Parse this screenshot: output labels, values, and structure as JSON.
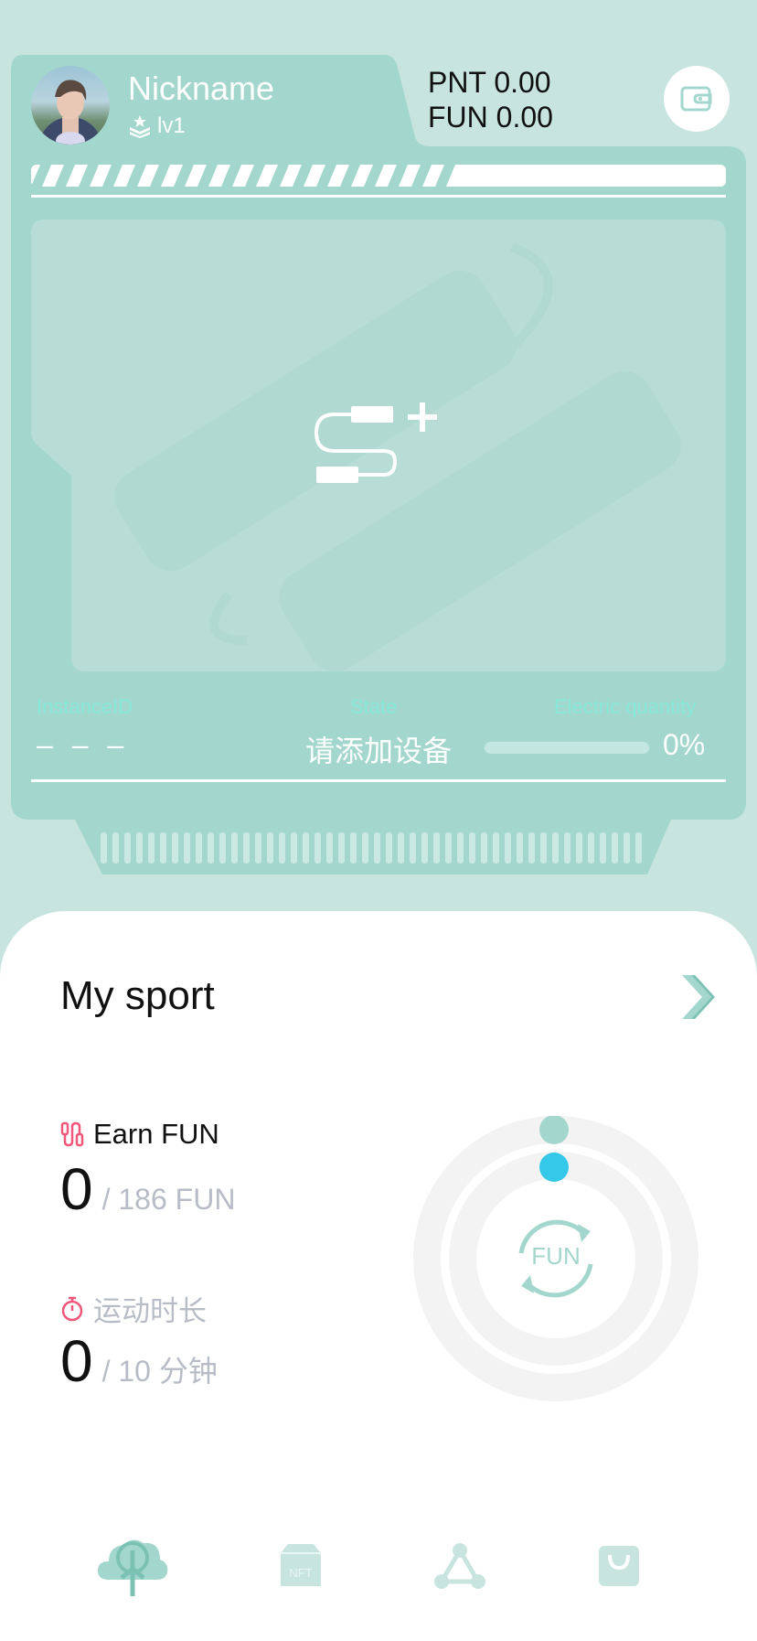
{
  "profile": {
    "nickname": "Nickname",
    "level": "lv1",
    "pnt_balance": "PNT 0.00",
    "fun_balance": "FUN 0.00"
  },
  "device": {
    "instance_label": "InstanceID",
    "instance_value": "– – –",
    "state_label": "State",
    "state_value": "请添加设备",
    "electric_label": "Electric quantity",
    "electric_value": "0%",
    "electric_fraction": 0,
    "experience_fraction": 0.6
  },
  "sport": {
    "title": "My sport",
    "earn_label": "Earn FUN",
    "earn_value": "0",
    "earn_goal": "/ 186 FUN",
    "duration_label": "运动时长",
    "duration_value": "0",
    "duration_goal": "/ 10 分钟",
    "ring_center_text": "FUN"
  },
  "icons": {
    "wallet": "wallet-icon",
    "add_device": "jump-rope-add-icon",
    "level": "level-badge-icon",
    "earn": "jump-rope-icon",
    "duration": "stopwatch-icon",
    "chevron": "chevron-right-icon"
  },
  "tabs": [
    {
      "name": "tab-sport",
      "icon": "sport-tree-icon",
      "active": true
    },
    {
      "name": "tab-nft",
      "icon": "nft-box-icon",
      "icon_text": "NFT",
      "active": false
    },
    {
      "name": "tab-network",
      "icon": "network-triangle-icon",
      "active": false
    },
    {
      "name": "tab-shop",
      "icon": "shopping-bag-icon",
      "active": false
    }
  ],
  "colors": {
    "background": "#c8e4de",
    "card": "#a3d7cd",
    "accent_mint": "#86e8d8",
    "cyan_dot": "#36c8e8",
    "earn_red": "#f0577a",
    "ring_gray": "#f3f3f3"
  }
}
